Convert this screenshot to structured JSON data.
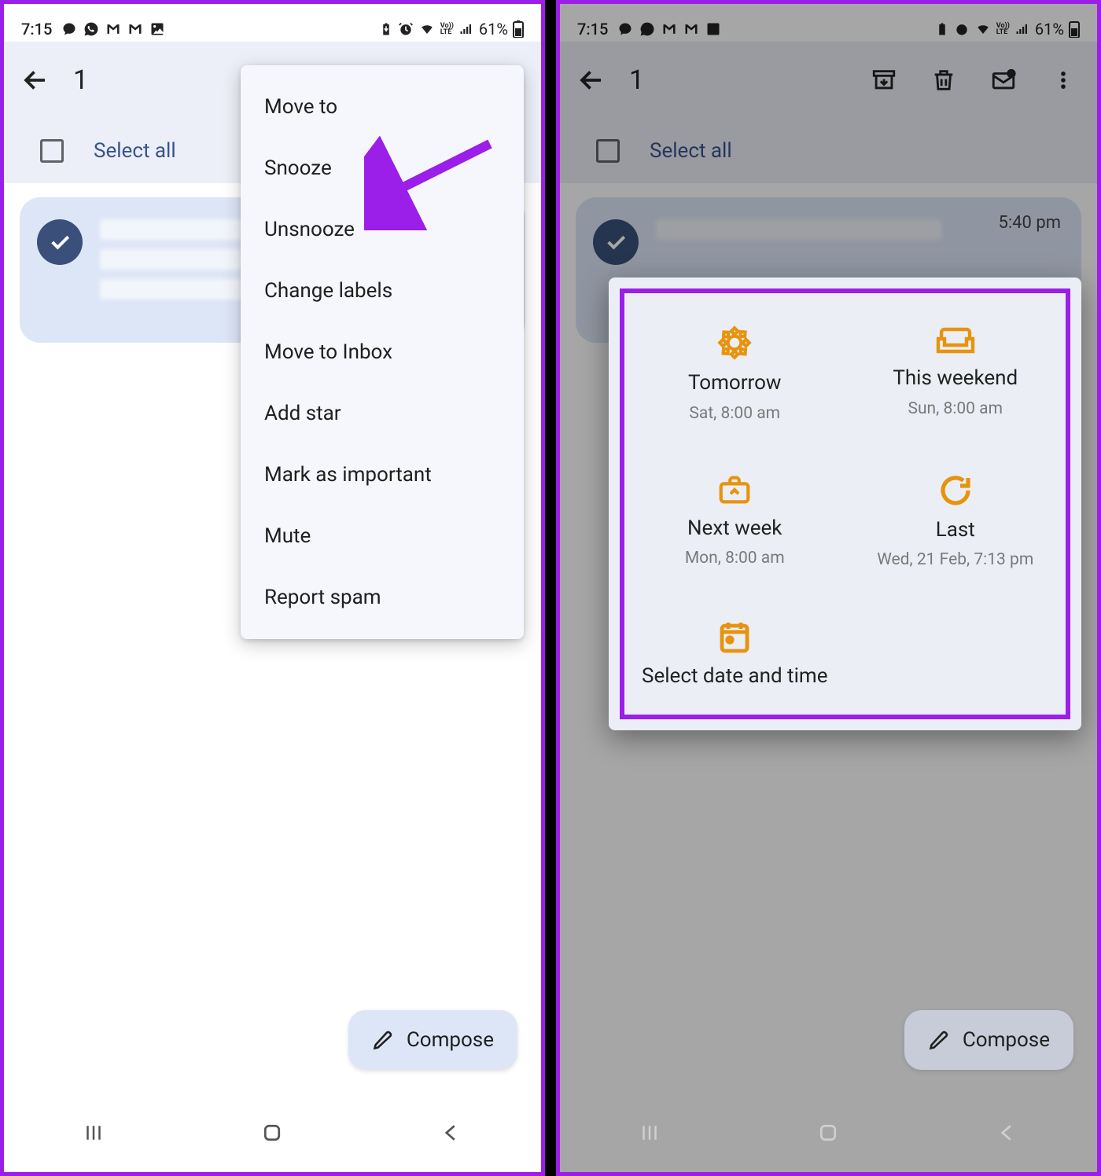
{
  "statusbar": {
    "time": "7:15",
    "battery_text": "61%"
  },
  "appbar": {
    "selected_count": "1"
  },
  "select_all_label": "Select all",
  "compose_label": "Compose",
  "email_time": "5:40 pm",
  "menu": {
    "items": [
      "Move to",
      "Snooze",
      "Unsnooze",
      "Change labels",
      "Move to Inbox",
      "Add star",
      "Mark as important",
      "Mute",
      "Report spam"
    ]
  },
  "snooze": {
    "options": [
      {
        "title": "Tomorrow",
        "sub": "Sat, 8:00 am"
      },
      {
        "title": "This weekend",
        "sub": "Sun, 8:00 am"
      },
      {
        "title": "Next week",
        "sub": "Mon, 8:00 am"
      },
      {
        "title": "Last",
        "sub": "Wed, 21 Feb, 7:13 pm"
      },
      {
        "title": "Select date and time",
        "sub": ""
      }
    ]
  }
}
